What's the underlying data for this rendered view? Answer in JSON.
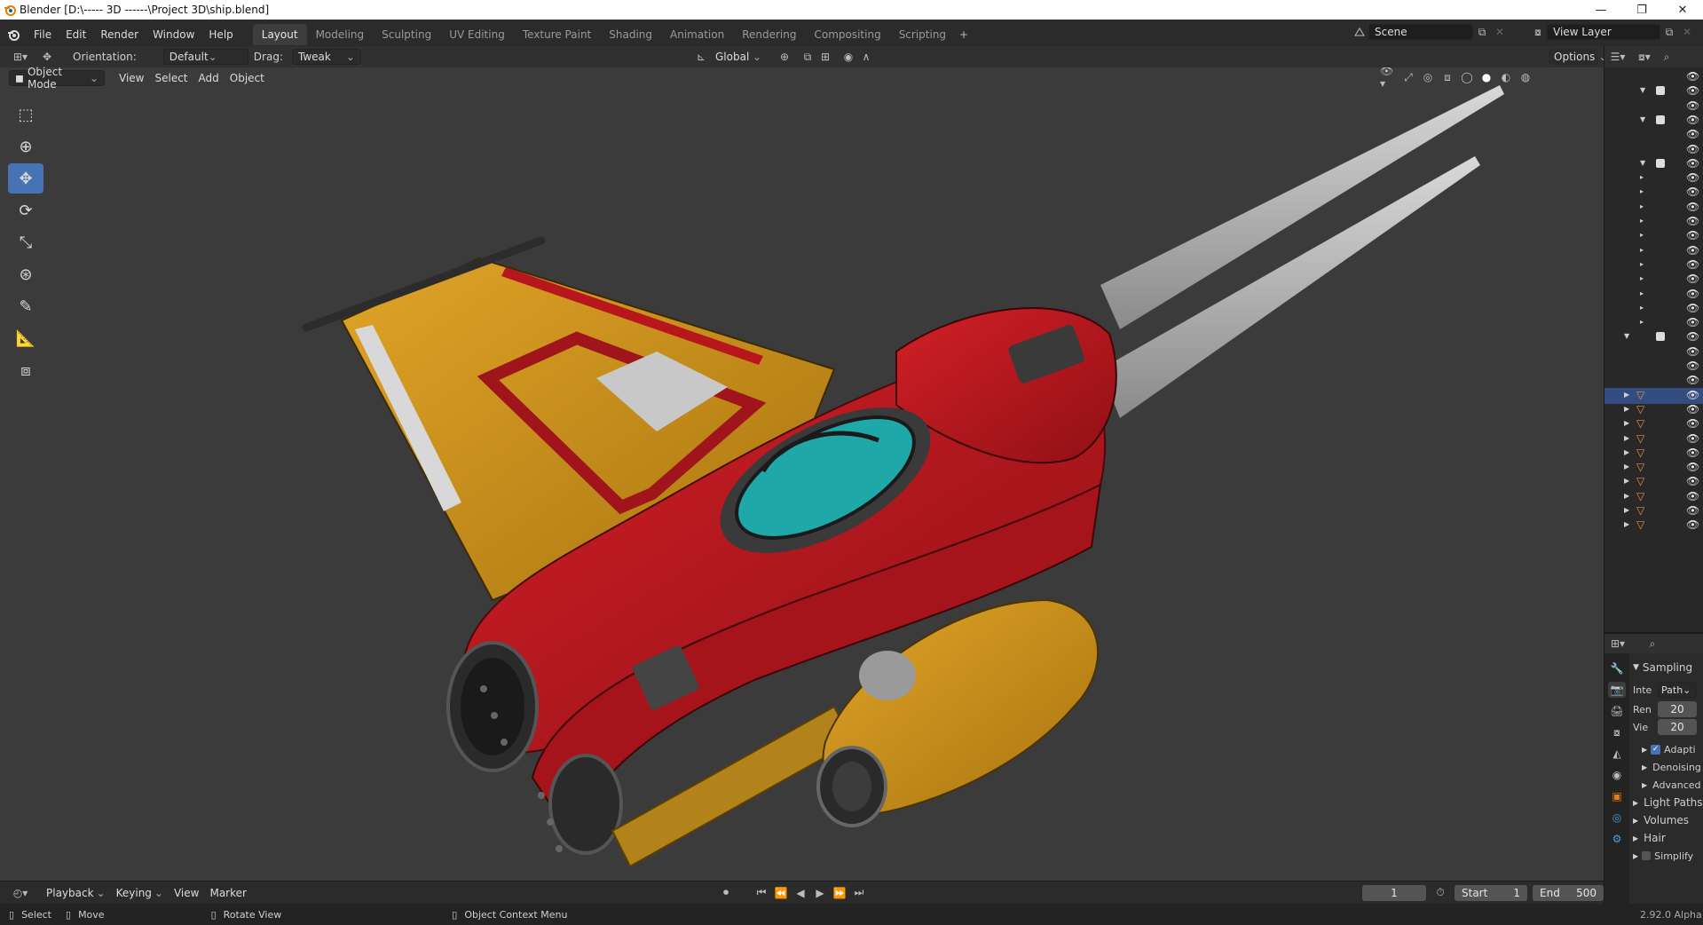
{
  "window": {
    "title": "Blender [D:\\----- 3D ------\\Project 3D\\ship.blend]",
    "minimize": "—",
    "restore": "❐",
    "close": "✕"
  },
  "menu": [
    "File",
    "Edit",
    "Render",
    "Window",
    "Help"
  ],
  "workspaces": [
    {
      "label": "Layout",
      "active": true
    },
    {
      "label": "Modeling",
      "active": false
    },
    {
      "label": "Sculpting",
      "active": false
    },
    {
      "label": "UV Editing",
      "active": false
    },
    {
      "label": "Texture Paint",
      "active": false
    },
    {
      "label": "Shading",
      "active": false
    },
    {
      "label": "Animation",
      "active": false
    },
    {
      "label": "Rendering",
      "active": false
    },
    {
      "label": "Compositing",
      "active": false
    },
    {
      "label": "Scripting",
      "active": false
    }
  ],
  "add_workspace": "+",
  "scene": {
    "value": "Scene"
  },
  "view_layer": {
    "value": "View Layer"
  },
  "tool_header": {
    "orientation_label": "Orientation:",
    "orientation_value": "Default",
    "drag_label": "Drag:",
    "drag_value": "Tweak",
    "transform_orientation": "Global",
    "options": "Options"
  },
  "viewport_header": {
    "mode": "Object Mode",
    "menus": [
      "View",
      "Select",
      "Add",
      "Object"
    ]
  },
  "toolbar": [
    "select-box",
    "cursor",
    "move",
    "rotate",
    "scale",
    "transform",
    "annotate",
    "measure",
    "add-cube"
  ],
  "outliner": {
    "selected_row": 22
  },
  "properties": {
    "sampling": "Sampling",
    "integrator_label": "Inte",
    "integrator_value": "Path",
    "render_label": "Ren",
    "render_value": "20",
    "viewport_label": "Vie",
    "viewport_value": "20",
    "adaptive": "Adapti",
    "denoising": "Denoising",
    "advanced": "Advanced",
    "light_paths": "Light Paths",
    "volumes": "Volumes",
    "hair": "Hair",
    "simplify": "Simplify",
    "version": "2.92.0 Alpha"
  },
  "timeline": {
    "playback": "Playback",
    "keying": "Keying",
    "view": "View",
    "marker": "Marker",
    "current_frame": "1",
    "start_label": "Start",
    "start_value": "1",
    "end_label": "End",
    "end_value": "500"
  },
  "statusbar": {
    "select": "Select",
    "move": "Move",
    "rotate_view": "Rotate View",
    "context_menu": "Object Context Menu"
  },
  "colors": {
    "ship_red": "#b5181e",
    "ship_yellow": "#c8901c",
    "canopy": "#1fa8a8",
    "accent_blue": "#4772b3"
  }
}
